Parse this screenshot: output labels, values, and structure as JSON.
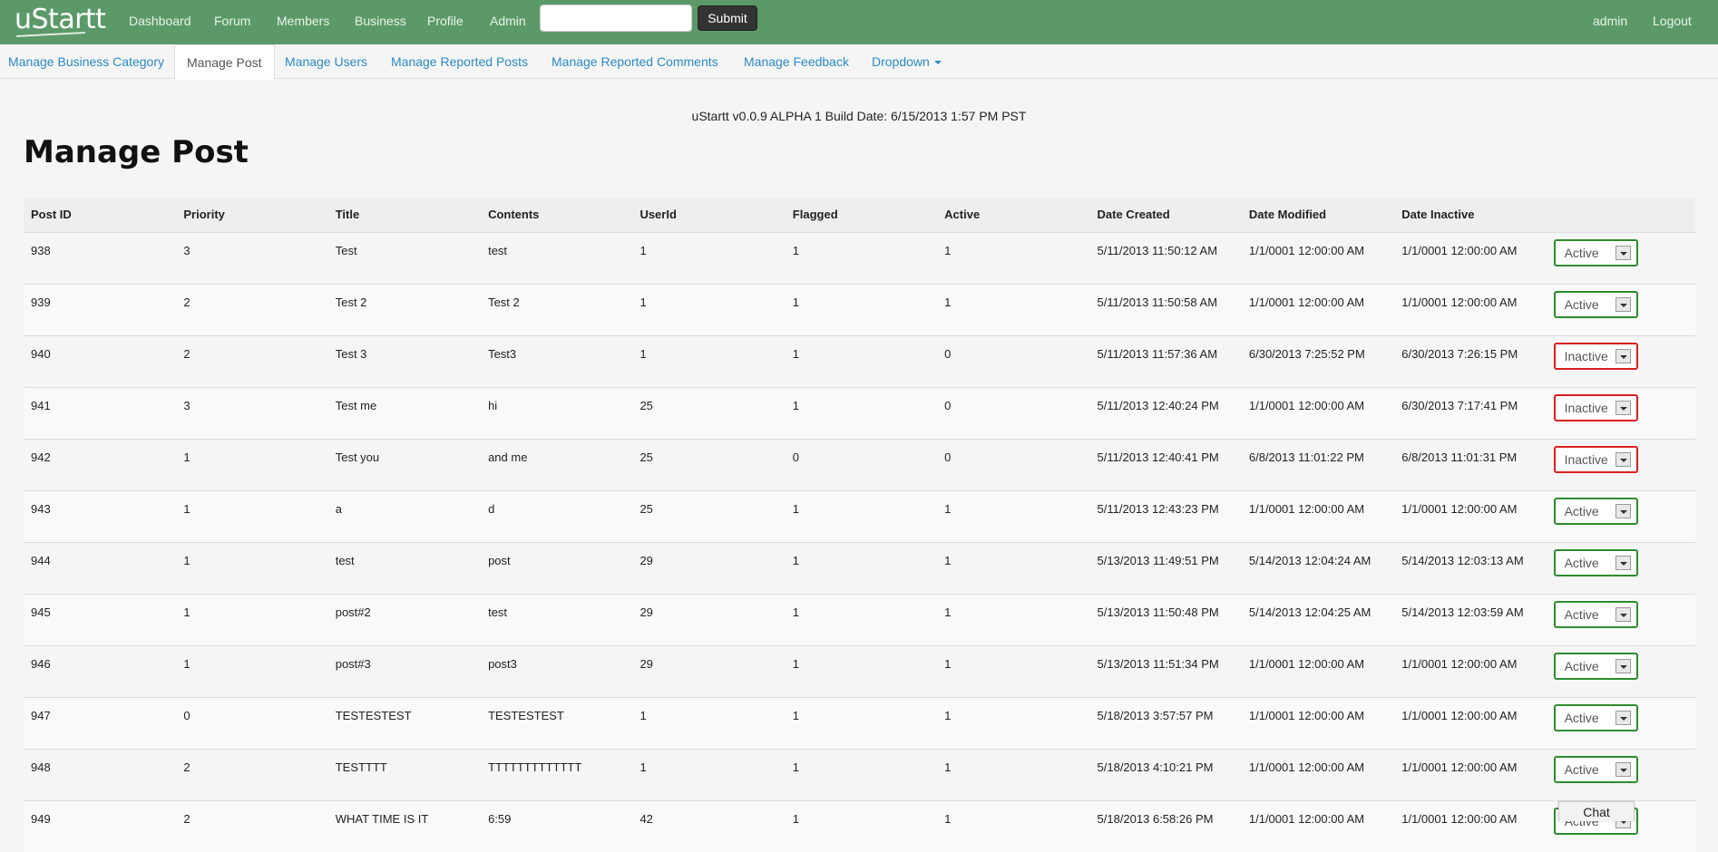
{
  "navbar": {
    "brand": "uStartt",
    "links": [
      "Dashboard",
      "Forum",
      "Members",
      "Business",
      "Profile",
      "Admin"
    ],
    "search_value": "",
    "submit_label": "Submit",
    "user": "admin",
    "logout": "Logout"
  },
  "tabs": [
    {
      "label": "Manage Business Category"
    },
    {
      "label": "Manage Post"
    },
    {
      "label": "Manage Users"
    },
    {
      "label": "Manage Reported Posts"
    },
    {
      "label": "Manage Reported Comments"
    },
    {
      "label": "Manage Feedback"
    },
    {
      "label": "Dropdown"
    }
  ],
  "build_info": "uStartt v0.0.9 ALPHA 1 Build Date: 6/15/2013 1:57 PM PST",
  "page_title": "Manage Post",
  "table": {
    "headers": [
      "Post ID",
      "Priority",
      "Title",
      "Contents",
      "UserId",
      "Flagged",
      "Active",
      "Date Created",
      "Date Modified",
      "Date Inactive",
      ""
    ],
    "rows": [
      {
        "id": "938",
        "priority": "3",
        "title": "Test",
        "contents": "test",
        "userid": "1",
        "flagged": "1",
        "active": "1",
        "created": "5/11/2013 11:50:12 AM",
        "modified": "1/1/0001 12:00:00 AM",
        "inactive": "1/1/0001 12:00:00 AM",
        "status": "Active"
      },
      {
        "id": "939",
        "priority": "2",
        "title": "Test 2",
        "contents": "Test 2",
        "userid": "1",
        "flagged": "1",
        "active": "1",
        "created": "5/11/2013 11:50:58 AM",
        "modified": "1/1/0001 12:00:00 AM",
        "inactive": "1/1/0001 12:00:00 AM",
        "status": "Active"
      },
      {
        "id": "940",
        "priority": "2",
        "title": "Test 3",
        "contents": "Test3",
        "userid": "1",
        "flagged": "1",
        "active": "0",
        "created": "5/11/2013 11:57:36 AM",
        "modified": "6/30/2013 7:25:52 PM",
        "inactive": "6/30/2013 7:26:15 PM",
        "status": "Inactive"
      },
      {
        "id": "941",
        "priority": "3",
        "title": "Test me",
        "contents": "hi",
        "userid": "25",
        "flagged": "1",
        "active": "0",
        "created": "5/11/2013 12:40:24 PM",
        "modified": "1/1/0001 12:00:00 AM",
        "inactive": "6/30/2013 7:17:41 PM",
        "status": "Inactive"
      },
      {
        "id": "942",
        "priority": "1",
        "title": "Test you",
        "contents": "and me",
        "userid": "25",
        "flagged": "0",
        "active": "0",
        "created": "5/11/2013 12:40:41 PM",
        "modified": "6/8/2013 11:01:22 PM",
        "inactive": "6/8/2013 11:01:31 PM",
        "status": "Inactive"
      },
      {
        "id": "943",
        "priority": "1",
        "title": "a",
        "contents": "d",
        "userid": "25",
        "flagged": "1",
        "active": "1",
        "created": "5/11/2013 12:43:23 PM",
        "modified": "1/1/0001 12:00:00 AM",
        "inactive": "1/1/0001 12:00:00 AM",
        "status": "Active"
      },
      {
        "id": "944",
        "priority": "1",
        "title": "test",
        "contents": "post",
        "userid": "29",
        "flagged": "1",
        "active": "1",
        "created": "5/13/2013 11:49:51 PM",
        "modified": "5/14/2013 12:04:24 AM",
        "inactive": "5/14/2013 12:03:13 AM",
        "status": "Active"
      },
      {
        "id": "945",
        "priority": "1",
        "title": "post#2",
        "contents": "test",
        "userid": "29",
        "flagged": "1",
        "active": "1",
        "created": "5/13/2013 11:50:48 PM",
        "modified": "5/14/2013 12:04:25 AM",
        "inactive": "5/14/2013 12:03:59 AM",
        "status": "Active"
      },
      {
        "id": "946",
        "priority": "1",
        "title": "post#3",
        "contents": "post3",
        "userid": "29",
        "flagged": "1",
        "active": "1",
        "created": "5/13/2013 11:51:34 PM",
        "modified": "1/1/0001 12:00:00 AM",
        "inactive": "1/1/0001 12:00:00 AM",
        "status": "Active"
      },
      {
        "id": "947",
        "priority": "0",
        "title": "TESTESTEST",
        "contents": "TESTESTEST",
        "userid": "1",
        "flagged": "1",
        "active": "1",
        "created": "5/18/2013 3:57:57 PM",
        "modified": "1/1/0001 12:00:00 AM",
        "inactive": "1/1/0001 12:00:00 AM",
        "status": "Active"
      },
      {
        "id": "948",
        "priority": "2",
        "title": "TESTTTT",
        "contents": "TTTTTTTTTTTTT",
        "userid": "1",
        "flagged": "1",
        "active": "1",
        "created": "5/18/2013 4:10:21 PM",
        "modified": "1/1/0001 12:00:00 AM",
        "inactive": "1/1/0001 12:00:00 AM",
        "status": "Active"
      },
      {
        "id": "949",
        "priority": "2",
        "title": "WHAT TIME IS IT",
        "contents": "6:59",
        "userid": "42",
        "flagged": "1",
        "active": "1",
        "created": "5/18/2013 6:58:26 PM",
        "modified": "1/1/0001 12:00:00 AM",
        "inactive": "1/1/0001 12:00:00 AM",
        "status": "Active"
      }
    ]
  },
  "chat_label": "Chat",
  "colors": {
    "navbar": "#5b9a68",
    "link": "#2a8ac7",
    "status_active_border": "#2e8b2e",
    "status_inactive_border": "#dd1f1f"
  }
}
